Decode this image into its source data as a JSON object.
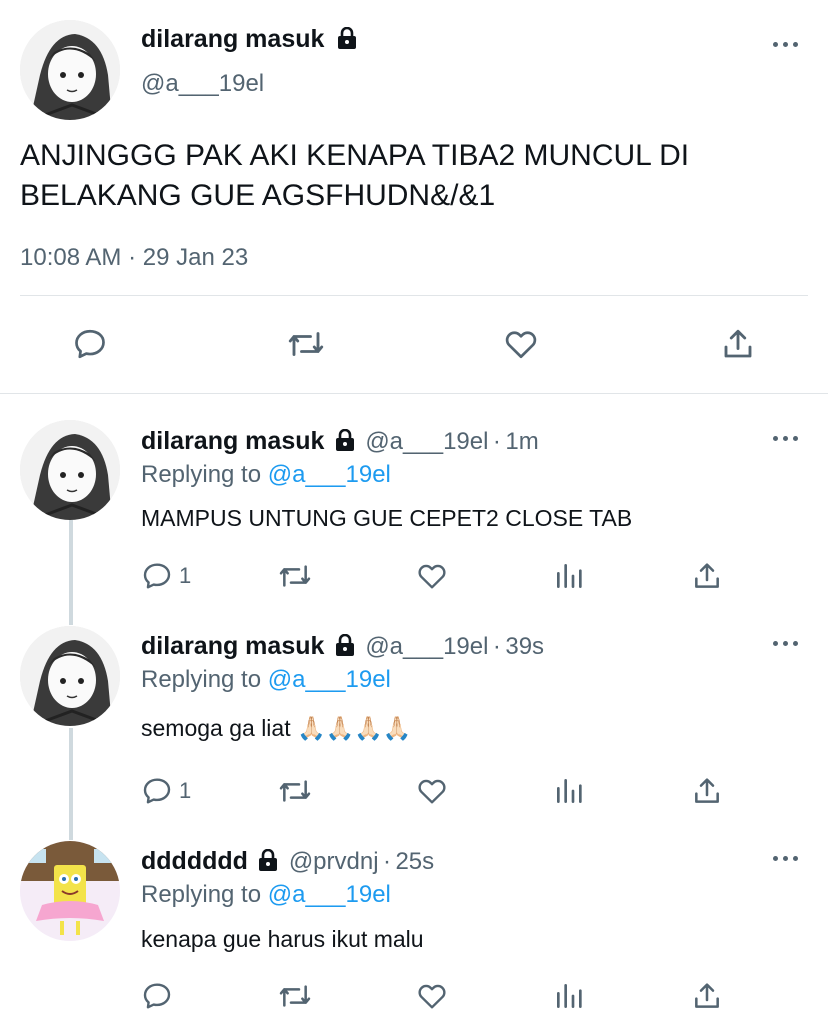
{
  "main_tweet": {
    "author_name": "dilarang masuk",
    "handle": "@a___19el",
    "text_line1": "ANJINGGG PAK AKI KENAPA TIBA2 MUNCUL DI",
    "text_line2": "BELAKANG GUE AGSFHUDN&/&1",
    "time": "10:08 AM",
    "dot": "·",
    "date": "29 Jan 23"
  },
  "replies": [
    {
      "author_name": "dilarang masuk",
      "handle": "@a___19el",
      "dot": "·",
      "age": "1m",
      "replying_prefix": "Replying to",
      "replying_to": "@a___19el",
      "text": "MAMPUS UNTUNG GUE CEPET2 CLOSE TAB",
      "reply_count": "1"
    },
    {
      "author_name": "dilarang masuk",
      "handle": "@a___19el",
      "dot": "·",
      "age": "39s",
      "replying_prefix": "Replying to",
      "replying_to": "@a___19el",
      "text": "semoga ga liat 🙏🏻🙏🏻🙏🏻🙏🏻",
      "reply_count": "1"
    },
    {
      "author_name": "ddddddd",
      "handle": "@prvdnj",
      "dot": "·",
      "age": "25s",
      "replying_prefix": "Replying to",
      "replying_to": "@a___19el",
      "text": "kenapa gue harus ikut malu",
      "reply_count": ""
    }
  ],
  "colors": {
    "accent": "#1d9bf0",
    "muted": "#536471",
    "text": "#0f1419",
    "divider": "#e1e5e8"
  },
  "icons": [
    "lock-icon",
    "more-icon",
    "reply-icon",
    "retweet-icon",
    "like-icon",
    "share-icon",
    "analytics-icon"
  ]
}
